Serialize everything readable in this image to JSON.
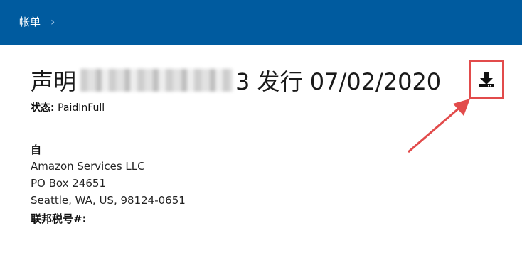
{
  "breadcrumb": {
    "label": "帐单",
    "chevron": "›"
  },
  "statement": {
    "title_prefix": "声明",
    "title_suffix": "3 发行 07/02/2020",
    "status_label": "状态:",
    "status_value": "PaidInFull"
  },
  "from": {
    "label": "自",
    "company": "Amazon Services LLC",
    "po_box": "PO Box 24651",
    "city_line": "Seattle, WA, US, 98124-0651",
    "tax_label": "联邦税号#:"
  },
  "icons": {
    "download": "download-icon"
  },
  "colors": {
    "header": "#005b9f",
    "annotation": "#e24b4b"
  }
}
